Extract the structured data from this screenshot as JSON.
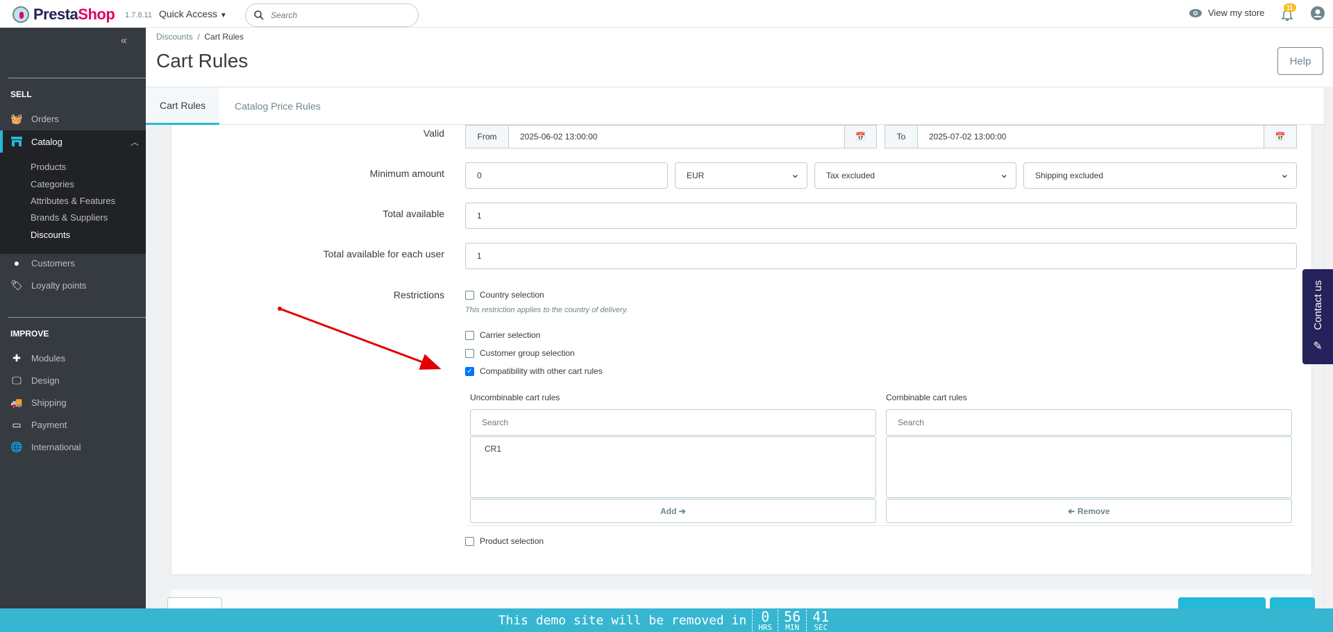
{
  "header": {
    "brand": "Presta",
    "brand2": "Shop",
    "version": "1.7.8.11",
    "quick_access": "Quick Access",
    "search_placeholder": "Search",
    "view_store": "View my store",
    "notifications_count": "11"
  },
  "sidebar": {
    "sell_heading": "SELL",
    "improve_heading": "IMPROVE",
    "items": [
      {
        "label": "Orders",
        "icon": "basket-icon"
      },
      {
        "label": "Catalog",
        "icon": "store-icon"
      },
      {
        "label": "Customers",
        "icon": "user-circle-icon"
      },
      {
        "label": "Loyalty points",
        "icon": "tag-icon"
      }
    ],
    "catalog_sub": [
      "Products",
      "Categories",
      "Attributes & Features",
      "Brands & Suppliers",
      "Discounts"
    ],
    "improve_items": [
      {
        "label": "Modules",
        "icon": "puzzle-icon"
      },
      {
        "label": "Design",
        "icon": "monitor-icon"
      },
      {
        "label": "Shipping",
        "icon": "truck-icon"
      },
      {
        "label": "Payment",
        "icon": "credit-card-icon"
      },
      {
        "label": "International",
        "icon": "globe-icon"
      }
    ]
  },
  "breadcrumb": {
    "parent": "Discounts",
    "current": "Cart Rules"
  },
  "page_title": "Cart Rules",
  "help_label": "Help",
  "tabs": [
    {
      "label": "Cart Rules",
      "active": true
    },
    {
      "label": "Catalog Price Rules",
      "active": false
    }
  ],
  "form": {
    "valid": {
      "label": "Valid",
      "from_label": "From",
      "from": "2025-06-02 13:00:00",
      "to_label": "To",
      "to": "2025-07-02 13:00:00"
    },
    "minimum_amount": {
      "label": "Minimum amount",
      "value": "0",
      "currency": "EUR",
      "tax": "Tax excluded",
      "shipping": "Shipping excluded"
    },
    "total_available": {
      "label": "Total available",
      "value": "1"
    },
    "total_per_user": {
      "label": "Total available for each user",
      "value": "1"
    },
    "restrictions": {
      "label": "Restrictions",
      "country": {
        "label": "Country selection",
        "checked": false,
        "hint": "This restriction applies to the country of delivery."
      },
      "carrier": {
        "label": "Carrier selection",
        "checked": false
      },
      "customer_group": {
        "label": "Customer group selection",
        "checked": false
      },
      "compatibility": {
        "label": "Compatibility with other cart rules",
        "checked": true
      },
      "uncombinable": {
        "label": "Uncombinable cart rules",
        "search_placeholder": "Search",
        "items": [
          "CR1"
        ],
        "button": "Add"
      },
      "combinable": {
        "label": "Combinable cart rules",
        "search_placeholder": "Search",
        "items": [],
        "button": "Remove"
      },
      "product": {
        "label": "Product selection",
        "checked": false
      }
    }
  },
  "banner": {
    "message": "This demo site will be removed in",
    "hours": "0",
    "hours_label": "HRS",
    "minutes": "56",
    "minutes_label": "MIN",
    "seconds": "41",
    "seconds_label": "SEC"
  },
  "contact": "Contact us",
  "colors": {
    "accent": "#25b9d7",
    "sidebar": "#363a41",
    "banner": "#36b6d1",
    "contact": "#25215a",
    "annotation_arrow": "#e00000"
  }
}
